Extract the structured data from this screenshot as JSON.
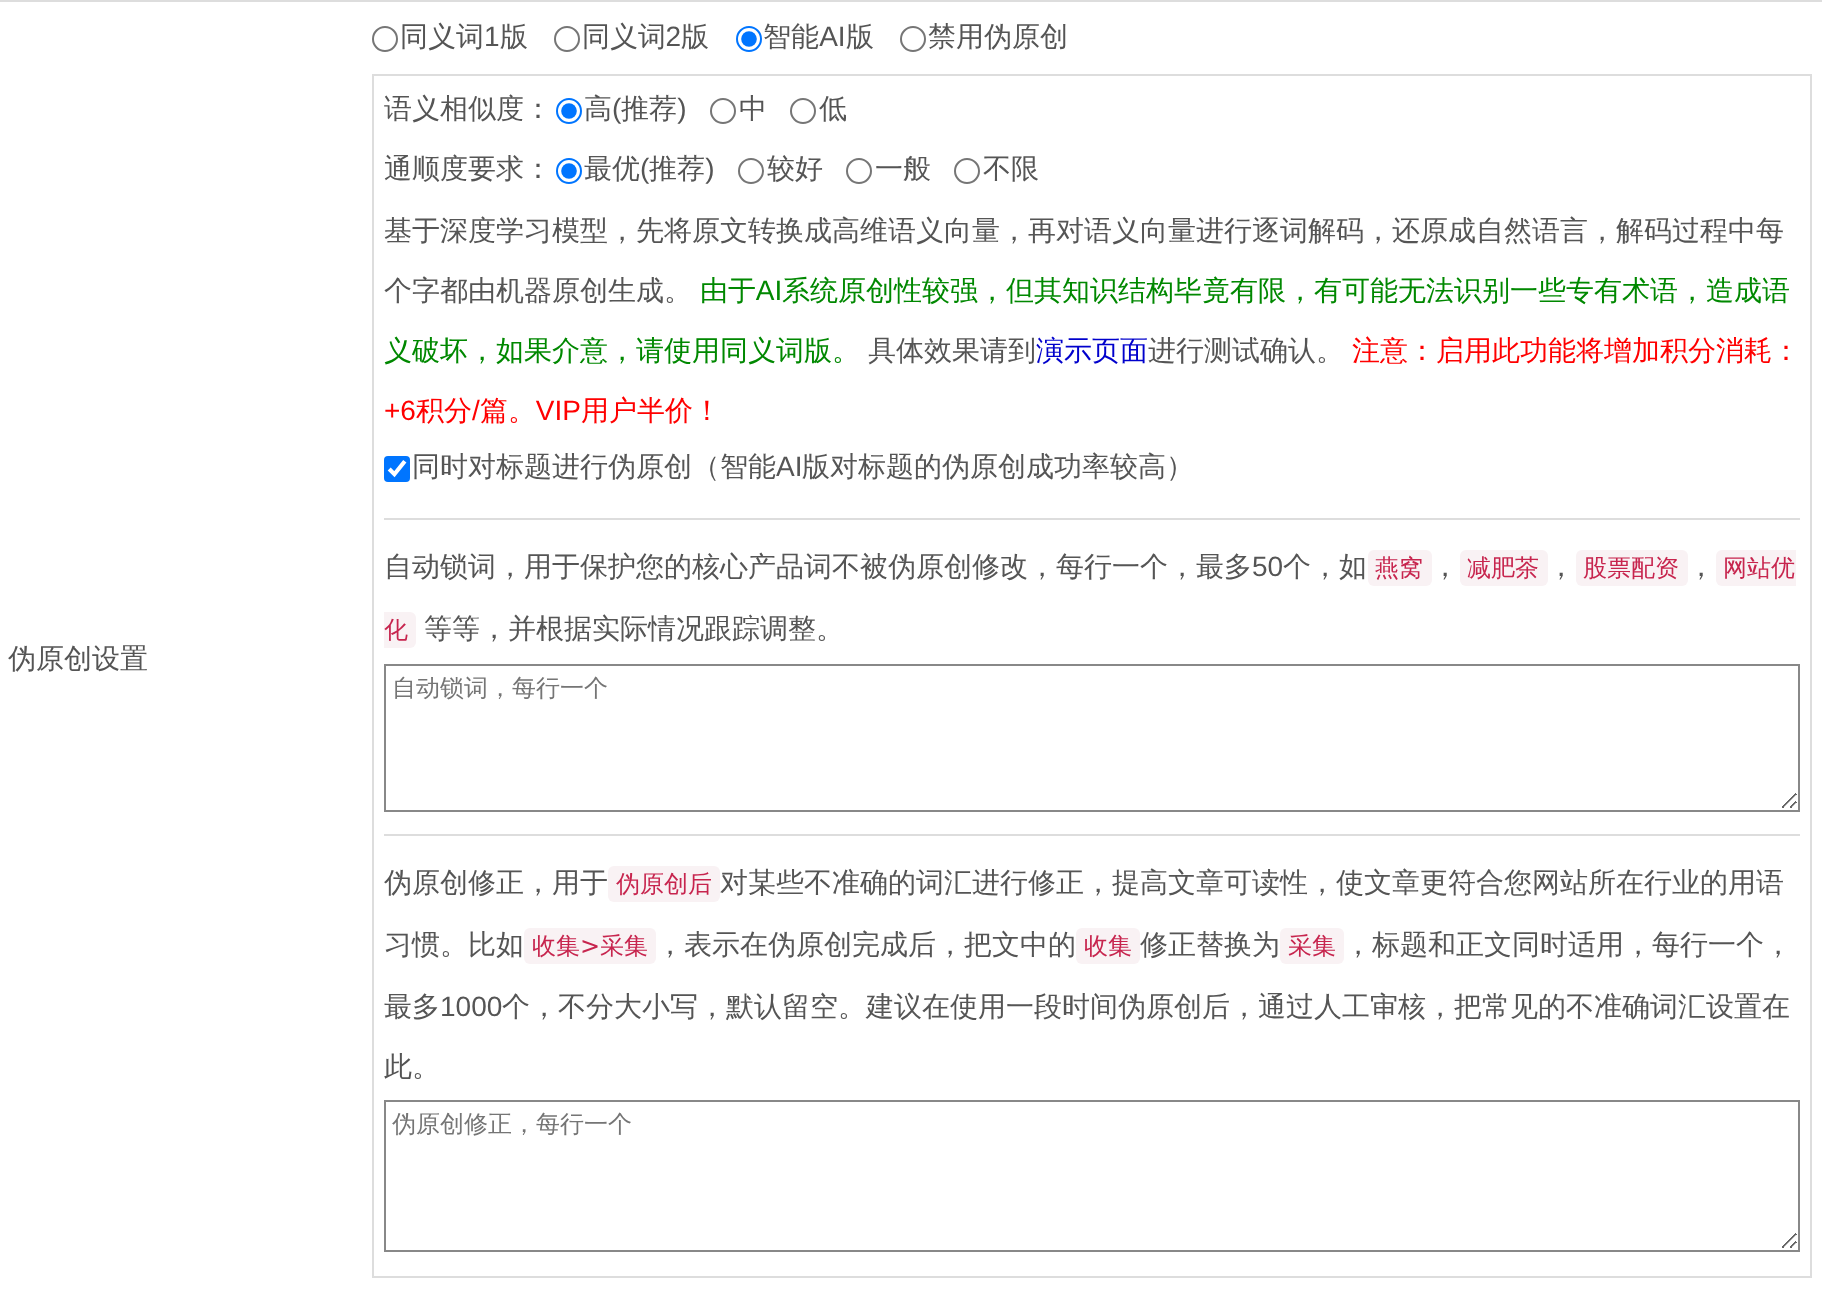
{
  "label": "伪原创设置",
  "modes": [
    {
      "label": "同义词1版",
      "selected": false
    },
    {
      "label": "同义词2版",
      "selected": false
    },
    {
      "label": "智能AI版",
      "selected": true
    },
    {
      "label": "禁用伪原创",
      "selected": false
    }
  ],
  "ai_options": [
    {
      "label": "语义相似度：",
      "options": [
        {
          "label": "高(推荐)",
          "selected": true
        },
        {
          "label": "中",
          "selected": false
        },
        {
          "label": "低",
          "selected": false
        }
      ]
    },
    {
      "label": "通顺度要求：",
      "options": [
        {
          "label": "最优(推荐)",
          "selected": true
        },
        {
          "label": "较好",
          "selected": false
        },
        {
          "label": "一般",
          "selected": false
        },
        {
          "label": "不限",
          "selected": false
        }
      ]
    }
  ],
  "ai_description": [
    {
      "kind": "plain",
      "text": "基于深度学习模型，先将原文转换成高维语义向量，再对语义向量进行逐词解码，还原成自然语言，解码过程中每个字都由机器原创生成。 "
    },
    {
      "kind": "notice",
      "text": "由于AI系统原创性较强，但其知识结构毕竟有限，有可能无法识别一些专有术语，造成语义破坏，如果介意，请使用同义词版。"
    },
    {
      "kind": "plain",
      "text": " 具体效果请到"
    },
    {
      "kind": "link",
      "text": "演示页面"
    },
    {
      "kind": "plain",
      "text": "进行测试确认。 "
    },
    {
      "kind": "warning",
      "text": "注意：启用此功能将增加积分消耗：+6积分/篇。VIP用户半价！"
    }
  ],
  "title_option": {
    "label": "同时对标题进行伪原创（智能AI版对标题的伪原创成功率较高）",
    "checked": true
  },
  "lock_words": {
    "description": [
      {
        "kind": "plain",
        "text": "自动锁词，用于保护您的核心产品词不被伪原创修改，每行一个，最多50个，如"
      },
      {
        "kind": "tag",
        "text": "燕窝"
      },
      {
        "kind": "plain",
        "text": "，"
      },
      {
        "kind": "tag",
        "text": "减肥茶"
      },
      {
        "kind": "plain",
        "text": "，"
      },
      {
        "kind": "tag",
        "text": "股票配资"
      },
      {
        "kind": "plain",
        "text": "，"
      },
      {
        "kind": "tag",
        "text": "网站优化"
      },
      {
        "kind": "plain",
        "text": " 等等，并根据实际情况跟踪调整。"
      }
    ],
    "placeholder": "自动锁词，每行一个"
  },
  "correction": {
    "description": [
      {
        "kind": "plain",
        "text": "伪原创修正，用于"
      },
      {
        "kind": "tag",
        "text": "伪原创后"
      },
      {
        "kind": "plain",
        "text": "对某些不准确的词汇进行修正，提高文章可读性，使文章更符合您网站所在行业的用语习惯。比如"
      },
      {
        "kind": "tag",
        "text": "收集>采集"
      },
      {
        "kind": "plain",
        "text": "，表示在伪原创完成后，把文中的"
      },
      {
        "kind": "tag",
        "text": "收集"
      },
      {
        "kind": "plain",
        "text": "修正替换为"
      },
      {
        "kind": "tag",
        "text": "采集"
      },
      {
        "kind": "plain",
        "text": "，标题和正文同时适用，每行一个，最多1000个，不分大小写，默认留空。建议在使用一段时间伪原创后，通过人工审核，把常见的不准确词汇设置在此。"
      }
    ],
    "placeholder": "伪原创修正，每行一个"
  }
}
